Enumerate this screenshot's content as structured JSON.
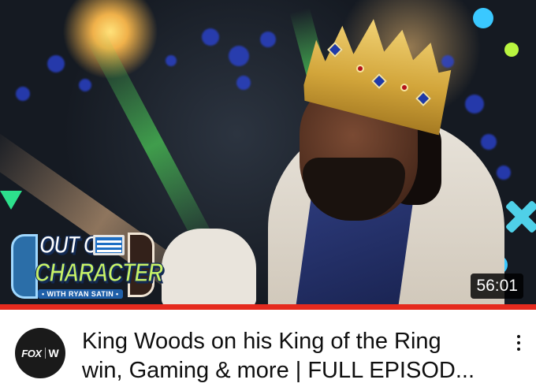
{
  "thumbnail": {
    "logo": {
      "line1": "OUT OF",
      "line2": "CHARACTER",
      "subtitle": "• WITH RYAN SATIN •"
    },
    "duration": "56:01",
    "progress_fraction": 1.0
  },
  "channel": {
    "avatar_text_left": "FOX",
    "avatar_text_right": "W"
  },
  "video": {
    "title_line1": "King Woods on his King of the Ring",
    "title_line2": "win, Gaming & more | FULL EPISOD..."
  },
  "icons": {
    "more": "more-vertical-icon"
  },
  "colors": {
    "progress": "#e52a1e",
    "duration_bg": "#000000",
    "title_text": "#0f0f0f"
  }
}
